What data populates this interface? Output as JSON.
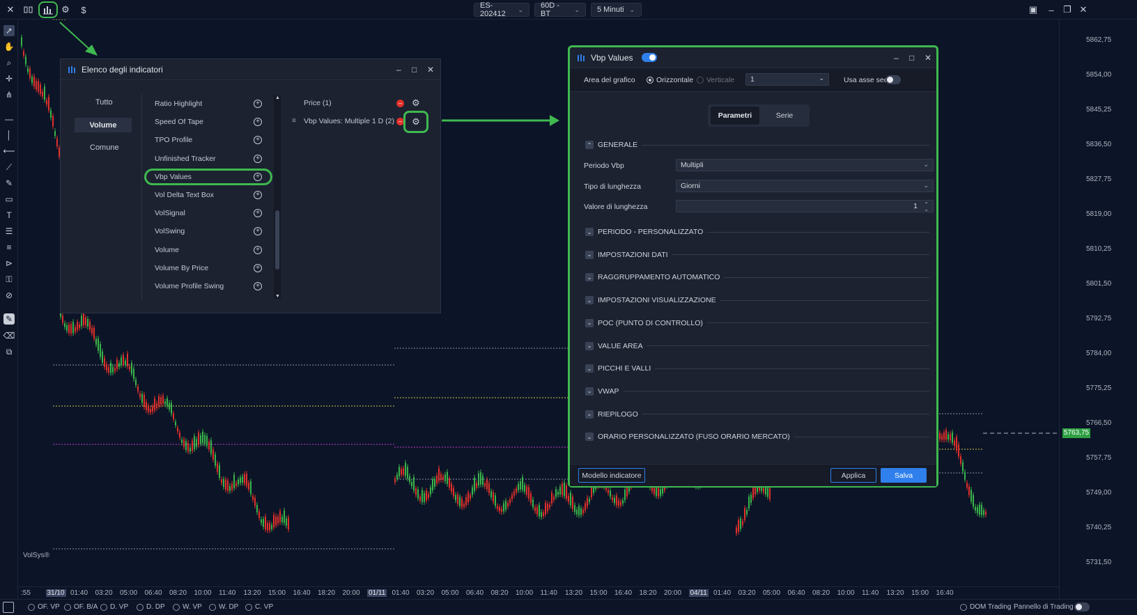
{
  "topbar": {
    "symbol": "ES-202412",
    "range": "60D - BT",
    "timeframe": "5 Minuti",
    "dollar_icon": "$"
  },
  "price_axis": [
    "5862,75",
    "5854,00",
    "5845,25",
    "5836,50",
    "5827,75",
    "5819,00",
    "5810,25",
    "5801,50",
    "5792,75",
    "5784,00",
    "5775,25",
    "5766,50",
    "5757,75",
    "5749,00",
    "5740,25",
    "5731,50"
  ],
  "current_price": "5763,75",
  "time_axis": [
    {
      "t": ":55",
      "hl": false
    },
    {
      "t": "31/10",
      "hl": true
    },
    {
      "t": "01:40",
      "hl": false
    },
    {
      "t": "03:20",
      "hl": false
    },
    {
      "t": "05:00",
      "hl": false
    },
    {
      "t": "06:40",
      "hl": false
    },
    {
      "t": "08:20",
      "hl": false
    },
    {
      "t": "10:00",
      "hl": false
    },
    {
      "t": "11:40",
      "hl": false
    },
    {
      "t": "13:20",
      "hl": false
    },
    {
      "t": "15:00",
      "hl": false
    },
    {
      "t": "16:40",
      "hl": false
    },
    {
      "t": "18:20",
      "hl": false
    },
    {
      "t": "20:00",
      "hl": false
    },
    {
      "t": "01/11",
      "hl": true
    },
    {
      "t": "01:40",
      "hl": false
    },
    {
      "t": "03:20",
      "hl": false
    },
    {
      "t": "05:00",
      "hl": false
    },
    {
      "t": "06:40",
      "hl": false
    },
    {
      "t": "08:20",
      "hl": false
    },
    {
      "t": "10:00",
      "hl": false
    },
    {
      "t": "11:40",
      "hl": false
    },
    {
      "t": "13:20",
      "hl": false
    },
    {
      "t": "15:00",
      "hl": false
    },
    {
      "t": "16:40",
      "hl": false
    },
    {
      "t": "18:20",
      "hl": false
    },
    {
      "t": "20:00",
      "hl": false
    },
    {
      "t": "04/11",
      "hl": true
    },
    {
      "t": "01:40",
      "hl": false
    },
    {
      "t": "03:20",
      "hl": false
    },
    {
      "t": "05:00",
      "hl": false
    },
    {
      "t": "06:40",
      "hl": false
    },
    {
      "t": "08:20",
      "hl": false
    },
    {
      "t": "10:00",
      "hl": false
    },
    {
      "t": "11:40",
      "hl": false
    },
    {
      "t": "13:20",
      "hl": false
    },
    {
      "t": "15:00",
      "hl": false
    },
    {
      "t": "16:40",
      "hl": false
    }
  ],
  "watermark": "VolSys®",
  "bottom": {
    "radios": [
      "OF. VP",
      "OF. B/A",
      "D. VP",
      "D. DP",
      "W. VP",
      "W. DP",
      "C. VP"
    ],
    "dom": "DOM Trading",
    "panel": "Pannello di Trading"
  },
  "indicator_list": {
    "title": "Elenco degli indicatori",
    "categories": [
      "Tutto",
      "Volume",
      "Comune"
    ],
    "items": [
      "Ratio Highlight",
      "Speed Of Tape",
      "TPO Profile",
      "Unfinished Tracker",
      "Vbp Values",
      "Vol Delta Text Box",
      "VolSignal",
      "VolSwing",
      "Volume",
      "Volume By Price",
      "Volume Profile Swing"
    ],
    "active": [
      "Price (1)",
      "Vbp Values: Multiple 1 D (2)"
    ]
  },
  "settings": {
    "title": "Vbp Values",
    "area_label": "Area del grafico",
    "orient_h": "Orizzontale",
    "orient_v": "Verticale",
    "pane_value": "1",
    "secondary_axis": "Usa asse sec.",
    "tab_params": "Parametri",
    "tab_series": "Serie",
    "general": "GENERALE",
    "period_label": "Periodo Vbp",
    "period_value": "Multipli",
    "length_type_label": "Tipo di lunghezza",
    "length_type_value": "Giorni",
    "length_value_label": "Valore di lunghezza",
    "length_value": "1",
    "sections": [
      "PERIODO - PERSONALIZZATO",
      "IMPOSTAZIONI DATI",
      "RAGGRUPPAMENTO AUTOMATICO",
      "IMPOSTAZIONI VISUALIZZAZIONE",
      "POC (PUNTO DI CONTROLLO)",
      "VALUE AREA",
      "PICCHI E VALLI",
      "VWAP",
      "RIEPILOGO",
      "ORARIO PERSONALIZZATO (FUSO ORARIO MERCATO)"
    ],
    "template_btn": "Modello indicatore",
    "apply_btn": "Applica",
    "save_btn": "Salva"
  },
  "colors": {
    "background": "#0c1427",
    "highlight": "#3fb950",
    "bull": "#39b54a",
    "bear": "#e0302a",
    "accent": "#2f80ed",
    "price_tag": "#2ea043"
  }
}
